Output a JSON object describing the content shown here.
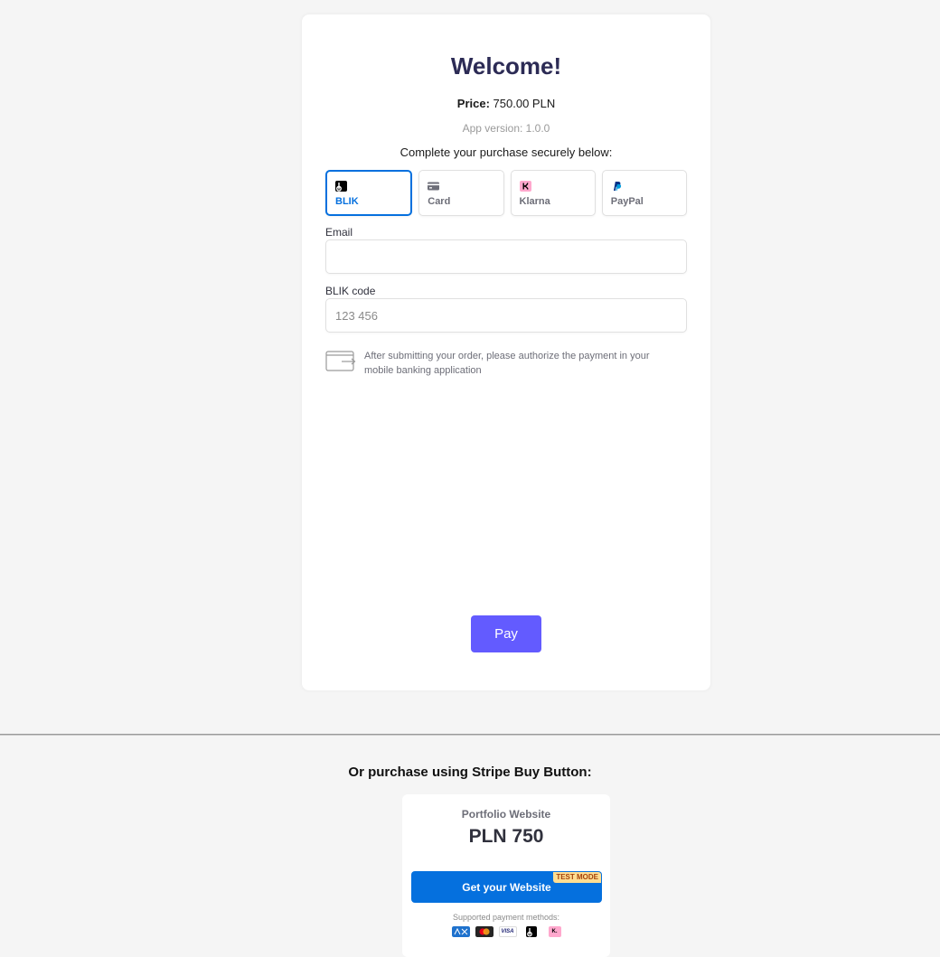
{
  "checkout": {
    "title": "Welcome!",
    "price_label": "Price:",
    "price_value": "750.00 PLN",
    "app_version": "App version: 1.0.0",
    "subtitle": "Complete your purchase securely below:",
    "tabs": [
      {
        "label": "BLIK",
        "icon": "blik-icon",
        "active": true
      },
      {
        "label": "Card",
        "icon": "card-icon",
        "active": false
      },
      {
        "label": "Klarna",
        "icon": "klarna-icon",
        "active": false
      },
      {
        "label": "PayPal",
        "icon": "paypal-icon",
        "active": false
      }
    ],
    "email": {
      "label": "Email",
      "value": "",
      "placeholder": ""
    },
    "blik_code": {
      "label": "BLIK code",
      "value": "",
      "placeholder": "123 456"
    },
    "notice": "After submitting your order, please authorize the payment in your mobile banking application",
    "pay_label": "Pay"
  },
  "buy_button_section": {
    "heading": "Or purchase using Stripe Buy Button:",
    "product_name": "Portfolio Website",
    "product_price": "PLN 750",
    "button_label": "Get your Website",
    "badge": "TEST MODE",
    "supported_label": "Supported payment methods:",
    "methods": [
      "amex-icon",
      "mastercard-icon",
      "visa-icon",
      "blik-icon",
      "klarna-icon"
    ],
    "method_text": {
      "visa": "VISA",
      "klarna": "K."
    }
  },
  "colors": {
    "accent": "#0570de",
    "pay_button": "#635bff",
    "title": "#2c2b55"
  }
}
